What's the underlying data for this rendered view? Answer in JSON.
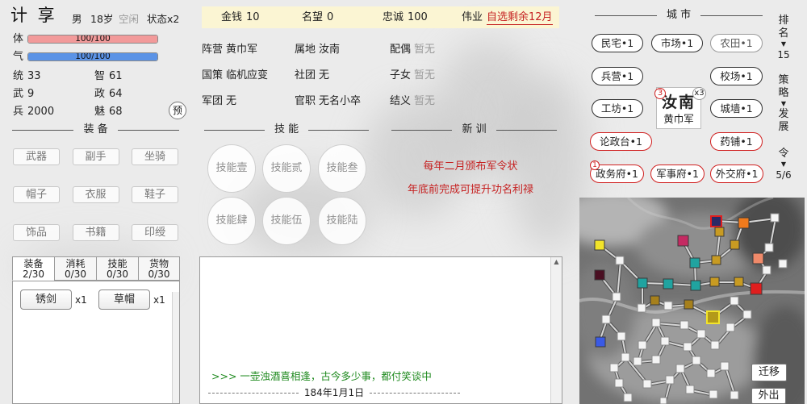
{
  "colors": {
    "stamina_bar": "#f29a9a",
    "energy_bar": "#5b93e6",
    "accent_red": "#c62222",
    "message_green": "#1f8a1f",
    "resource_bar_bg": "#fbf5d3"
  },
  "character": {
    "name": "计 享",
    "gender": "男",
    "age": "18岁",
    "activity": "空闲",
    "status": "状态x2"
  },
  "bars": {
    "stamina": {
      "label": "体",
      "text": "100/100",
      "fraction": 1.0
    },
    "energy": {
      "label": "气",
      "text": "100/100",
      "fraction": 1.0
    }
  },
  "stats": [
    {
      "label": "统",
      "value": "33"
    },
    {
      "label": "智",
      "value": "61"
    },
    {
      "label": "武",
      "value": "9"
    },
    {
      "label": "政",
      "value": "64"
    },
    {
      "label": "兵",
      "value": "2000"
    },
    {
      "label": "魅",
      "value": "68"
    }
  ],
  "preview_button": "预",
  "equipment": {
    "title": "装 备",
    "slots": [
      "武器",
      "副手",
      "坐骑",
      "帽子",
      "衣服",
      "鞋子",
      "饰品",
      "书籍",
      "印绶"
    ]
  },
  "inventory": {
    "tabs": [
      {
        "label": "装备",
        "count": "2/30",
        "active": true
      },
      {
        "label": "消耗",
        "count": "0/30",
        "active": false
      },
      {
        "label": "技能",
        "count": "0/30",
        "active": false
      },
      {
        "label": "货物",
        "count": "0/30",
        "active": false
      }
    ],
    "items": [
      {
        "name": "锈剑",
        "qty": "x1"
      },
      {
        "name": "草帽",
        "qty": "x1"
      }
    ]
  },
  "resources": [
    {
      "label": "金钱",
      "value": "10"
    },
    {
      "label": "名望",
      "value": "0"
    },
    {
      "label": "忠诚",
      "value": "100"
    },
    {
      "label": "伟业",
      "value": "自选剩余12月"
    }
  ],
  "info": [
    {
      "label": "阵营",
      "value": "黄巾军"
    },
    {
      "label": "属地",
      "value": "汝南"
    },
    {
      "label": "配偶",
      "value": "暂无"
    },
    {
      "label": "国策",
      "value": "临机应变"
    },
    {
      "label": "社团",
      "value": "无"
    },
    {
      "label": "子女",
      "value": "暂无"
    },
    {
      "label": "军团",
      "value": "无"
    },
    {
      "label": "官职",
      "value": "无名小卒"
    },
    {
      "label": "结义",
      "value": "暂无"
    }
  ],
  "skills": {
    "title": "技 能",
    "slots": [
      "技能壹",
      "技能贰",
      "技能叁",
      "技能肆",
      "技能伍",
      "技能陆"
    ]
  },
  "news": {
    "title": "新 训",
    "lines": [
      "每年二月颁布军令状",
      "年底前完成可提升功名利禄"
    ]
  },
  "log": {
    "message": ">>> 一壶浊酒喜相逢，古今多少事，都付笑谈中",
    "date": "184年1月1日"
  },
  "city": {
    "title": "城 市",
    "name": "汝南",
    "faction": "黄巾军",
    "badge": "3",
    "multiplier": "x3",
    "buildings": [
      {
        "label": "民宅•1",
        "highlighted": false
      },
      {
        "label": "市场•1",
        "highlighted": false
      },
      {
        "label": "农田•1",
        "highlighted": false
      },
      {
        "label": "兵营•1",
        "highlighted": false
      },
      {
        "label": "校场•1",
        "highlighted": false
      },
      {
        "label": "工坊•1",
        "highlighted": false
      },
      {
        "label": "城墙•1",
        "highlighted": false
      },
      {
        "label": "论政台•1",
        "highlighted": true
      },
      {
        "label": "药铺•1",
        "highlighted": true
      },
      {
        "label": "政务府•1",
        "highlighted": true,
        "badge": "1"
      },
      {
        "label": "军事府•1",
        "highlighted": true
      },
      {
        "label": "外交府•1",
        "highlighted": true
      }
    ]
  },
  "sidebar": {
    "ranking": {
      "label": "排名",
      "value": "15"
    },
    "strategy": {
      "label": "策略",
      "value": "发展"
    },
    "order": {
      "label": "令",
      "value": "5/6"
    }
  },
  "map": {
    "migrate_button": "迁移",
    "go_out_button": "外出",
    "faction_colors": [
      "#2a2a66",
      "#f07a1c",
      "#c89b22",
      "#c42a62",
      "#f2e42a",
      "#f08a6a",
      "#20a3a0",
      "#4a0f22",
      "#e01e1e",
      "#a6801c",
      "#b39a1a",
      "#3a5ae6",
      "#f4f4f4"
    ]
  }
}
